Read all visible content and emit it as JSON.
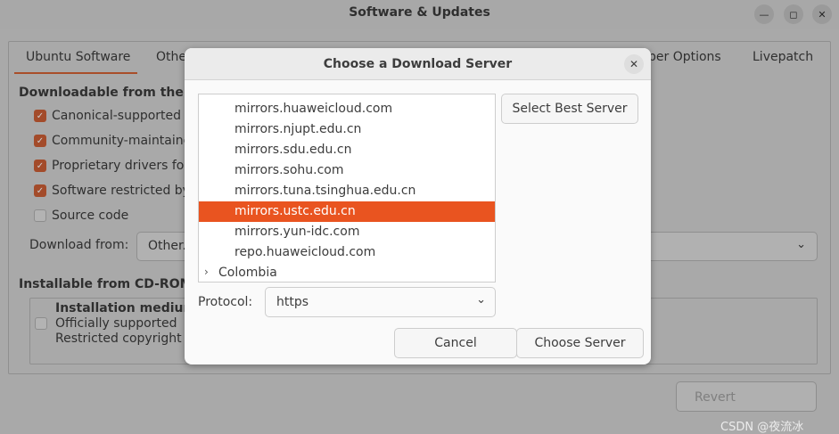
{
  "window": {
    "title": "Software & Updates",
    "controls": {
      "minimize": "minimize-icon",
      "maximize": "maximize-icon",
      "close": "close-icon"
    }
  },
  "tabs": [
    {
      "label": "Ubuntu Software",
      "active": true
    },
    {
      "label": "Othe"
    },
    {
      "label": "per Options"
    },
    {
      "label": "Livepatch"
    }
  ],
  "main": {
    "downloadable_title": "Downloadable from the In",
    "checkboxes": [
      {
        "label": "Canonical-supported fr",
        "checked": true
      },
      {
        "label": "Community-maintained",
        "checked": true
      },
      {
        "label": "Proprietary drivers for",
        "checked": true
      },
      {
        "label": "Software restricted by",
        "checked": true
      },
      {
        "label": "Source code",
        "checked": false
      }
    ],
    "download_from_label": "Download from:",
    "download_from_value": "Other...",
    "cdrom_title": "Installable from CD-ROM/",
    "cdrom": {
      "checked": false,
      "line1": "Installation medium",
      "line2": "Officially supported",
      "line3": "Restricted copyright"
    },
    "revert_label": "Revert",
    "watermark": "CSDN @夜流冰"
  },
  "dialog": {
    "title": "Choose a Download Server",
    "servers": [
      {
        "name": "mirrors.huaweicloud.com",
        "selected": false
      },
      {
        "name": "mirrors.njupt.edu.cn",
        "selected": false
      },
      {
        "name": "mirrors.sdu.edu.cn",
        "selected": false
      },
      {
        "name": "mirrors.sohu.com",
        "selected": false
      },
      {
        "name": "mirrors.tuna.tsinghua.edu.cn",
        "selected": false
      },
      {
        "name": "mirrors.ustc.edu.cn",
        "selected": true
      },
      {
        "name": "mirrors.yun-idc.com",
        "selected": false
      },
      {
        "name": "repo.huaweicloud.com",
        "selected": false
      }
    ],
    "collapsed_group": "Colombia",
    "select_best_label": "Select Best Server",
    "protocol_label": "Protocol:",
    "protocol_value": "https",
    "cancel_label": "Cancel",
    "choose_label": "Choose Server",
    "selection_color": "#e95420"
  }
}
